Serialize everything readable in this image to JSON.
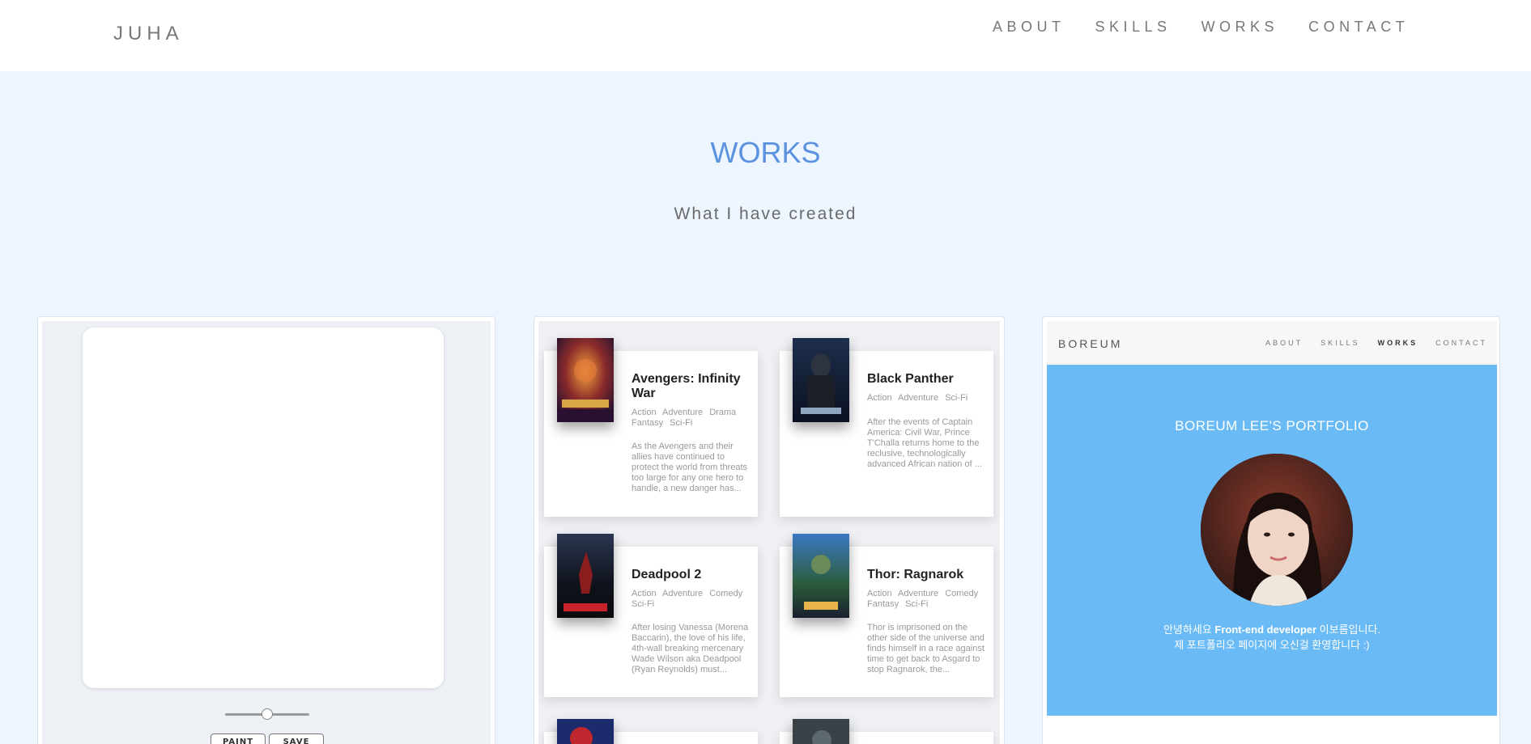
{
  "nav": {
    "logo": "JUHA",
    "links": [
      "ABOUT",
      "SKILLS",
      "WORKS",
      "CONTACT"
    ]
  },
  "section": {
    "title": "WORKS",
    "subtitle": "What I have created"
  },
  "paint_app": {
    "paint_label": "PAINT",
    "save_label": "SAVE",
    "brush_size_value": 0.5
  },
  "movie_app": {
    "movies": [
      {
        "title": "Avengers: Infinity War",
        "genres": "Action Adventure Drama Fantasy Sci-Fi",
        "description": "As the Avengers and their allies have continued to protect the world from threats too large for any one hero to handle, a new danger has..."
      },
      {
        "title": "Black Panther",
        "genres": "Action Adventure Sci-Fi",
        "description": "After the events of Captain America: Civil War, Prince T'Challa returns home to the reclusive, technologically advanced African nation of ..."
      },
      {
        "title": "Deadpool 2",
        "genres": "Action Adventure Comedy Sci-Fi",
        "description": "After losing Vanessa (Morena Baccarin), the love of his life, 4th-wall breaking mercenary Wade Wilson aka Deadpool (Ryan Reynolds) must..."
      },
      {
        "title": "Thor: Ragnarok",
        "genres": "Action Adventure Comedy Fantasy Sci-Fi",
        "description": "Thor is imprisoned on the other side of the universe and finds himself in a race against time to get back to Asgard to stop Ragnarok, the..."
      }
    ]
  },
  "portfolio_app": {
    "logo": "BOREUM",
    "links": [
      "ABOUT",
      "SKILLS",
      "WORKS",
      "CONTACT"
    ],
    "active_link": "WORKS",
    "title": "BOREUM LEE'S PORTFOLIO",
    "intro_line1_pre": "안녕하세요 ",
    "intro_line1_bold": "Front-end developer",
    "intro_line1_post": " 이보름입니다.",
    "intro_line2": "제 포트폴리오 페이지에 오신걸 환영합니다 :)"
  },
  "colors": {
    "background": "#edf5fe",
    "accent": "#5a92e0",
    "portfolio_hero": "#6abaf5"
  }
}
